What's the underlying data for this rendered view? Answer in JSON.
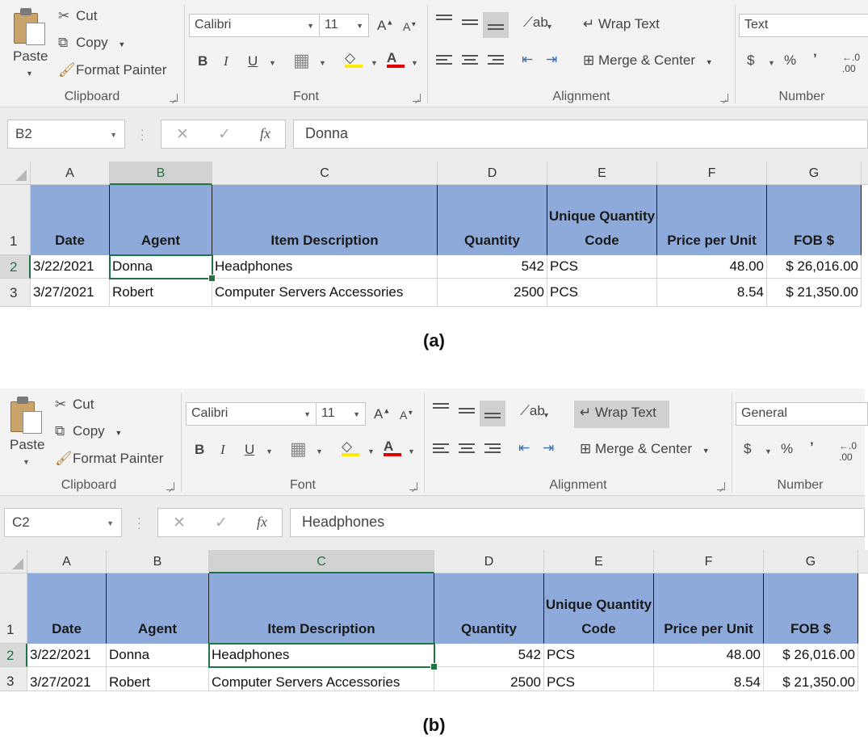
{
  "ribbon": {
    "clipboard": {
      "paste": "Paste",
      "cut": "Cut",
      "copy": "Copy",
      "format_painter": "Format Painter",
      "group_label": "Clipboard"
    },
    "font": {
      "name": "Calibri",
      "size": "11",
      "bold": "B",
      "italic": "I",
      "underline": "U",
      "group_label": "Font"
    },
    "alignment": {
      "wrap_text": "Wrap Text",
      "merge_center": "Merge & Center",
      "group_label": "Alignment"
    },
    "number": {
      "group_label": "Number",
      "currency": "$",
      "percent": "%",
      "comma": "’"
    }
  },
  "columns": [
    "A",
    "B",
    "C",
    "D",
    "E",
    "F",
    "G"
  ],
  "header_row": {
    "row_number": "1",
    "cells": [
      "Date",
      "Agent",
      "Item Description",
      "Quantity",
      "Unique Quantity Code",
      "Price per Unit",
      "FOB $"
    ]
  },
  "rows": [
    {
      "row_number": "2",
      "date": "3/22/2021",
      "agent": "Donna",
      "item": "Headphones",
      "quantity": "542",
      "code": "PCS",
      "price": "48.00",
      "fob": "$ 26,016.00"
    },
    {
      "row_number": "3",
      "date": "3/27/2021",
      "agent": "Robert",
      "item": "Computer Servers Accessories",
      "quantity": "2500",
      "code": "PCS",
      "price": "8.54",
      "fob": "$ 21,350.00"
    }
  ],
  "panels": [
    {
      "caption": "(a)",
      "number_format": "Text",
      "name_box": "B2",
      "formula": "Donna",
      "selected_column": "B",
      "wrap_text_active": false
    },
    {
      "caption": "(b)",
      "number_format": "General",
      "name_box": "C2",
      "formula": "Headphones",
      "selected_column": "C",
      "wrap_text_active": true
    }
  ],
  "colors": {
    "header_fill": "#8eaadb",
    "selection": "#217346",
    "ribbon": "#f3f3f3"
  }
}
